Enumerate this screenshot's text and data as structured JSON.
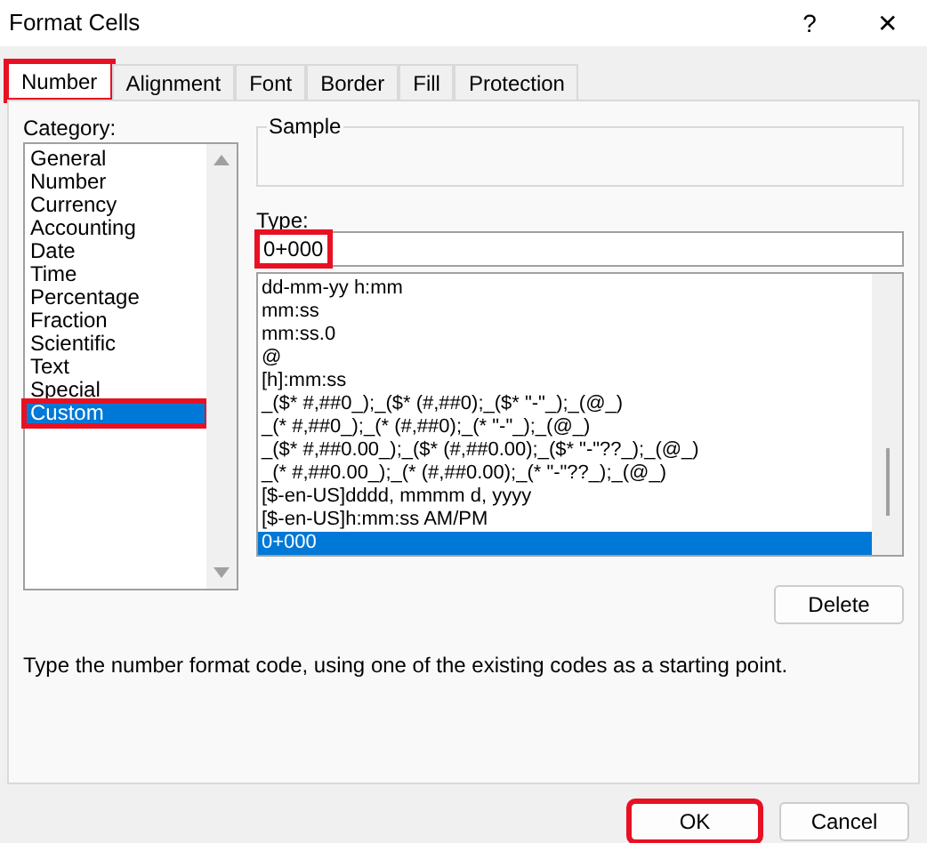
{
  "window": {
    "title": "Format Cells",
    "help": "?",
    "close": "✕"
  },
  "tabs": [
    {
      "label": "Number",
      "selected": true,
      "highlighted": true
    },
    {
      "label": "Alignment",
      "selected": false,
      "highlighted": false
    },
    {
      "label": "Font",
      "selected": false,
      "highlighted": false
    },
    {
      "label": "Border",
      "selected": false,
      "highlighted": false
    },
    {
      "label": "Fill",
      "selected": false,
      "highlighted": false
    },
    {
      "label": "Protection",
      "selected": false,
      "highlighted": false
    }
  ],
  "category": {
    "label": "Category:",
    "items": [
      {
        "label": "General",
        "selected": false,
        "highlighted": false
      },
      {
        "label": "Number",
        "selected": false,
        "highlighted": false
      },
      {
        "label": "Currency",
        "selected": false,
        "highlighted": false
      },
      {
        "label": "Accounting",
        "selected": false,
        "highlighted": false
      },
      {
        "label": "Date",
        "selected": false,
        "highlighted": false
      },
      {
        "label": "Time",
        "selected": false,
        "highlighted": false
      },
      {
        "label": "Percentage",
        "selected": false,
        "highlighted": false
      },
      {
        "label": "Fraction",
        "selected": false,
        "highlighted": false
      },
      {
        "label": "Scientific",
        "selected": false,
        "highlighted": false
      },
      {
        "label": "Text",
        "selected": false,
        "highlighted": false
      },
      {
        "label": "Special",
        "selected": false,
        "highlighted": false
      },
      {
        "label": "Custom",
        "selected": true,
        "highlighted": true
      }
    ]
  },
  "sample": {
    "label": "Sample"
  },
  "type": {
    "label": "Type:",
    "value": "0+000",
    "highlighted": true,
    "items": [
      {
        "label": "dd-mm-yy h:mm",
        "selected": false
      },
      {
        "label": "mm:ss",
        "selected": false
      },
      {
        "label": "mm:ss.0",
        "selected": false
      },
      {
        "label": "@",
        "selected": false
      },
      {
        "label": "[h]:mm:ss",
        "selected": false
      },
      {
        "label": "_($* #,##0_);_($* (#,##0);_($* \"-\"_);_(@_)",
        "selected": false
      },
      {
        "label": "_(* #,##0_);_(* (#,##0);_(* \"-\"_);_(@_)",
        "selected": false
      },
      {
        "label": "_($* #,##0.00_);_($* (#,##0.00);_($* \"-\"??_);_(@_)",
        "selected": false
      },
      {
        "label": "_(* #,##0.00_);_(* (#,##0.00);_(* \"-\"??_);_(@_)",
        "selected": false
      },
      {
        "label": "[$-en-US]dddd, mmmm d, yyyy",
        "selected": false
      },
      {
        "label": "[$-en-US]h:mm:ss AM/PM",
        "selected": false
      },
      {
        "label": "0+000",
        "selected": true
      }
    ]
  },
  "delete_button": "Delete",
  "hint": "Type the number format code, using one of the existing codes as a starting point.",
  "buttons": [
    {
      "label": "OK",
      "highlighted": true
    },
    {
      "label": "Cancel",
      "highlighted": false
    }
  ]
}
